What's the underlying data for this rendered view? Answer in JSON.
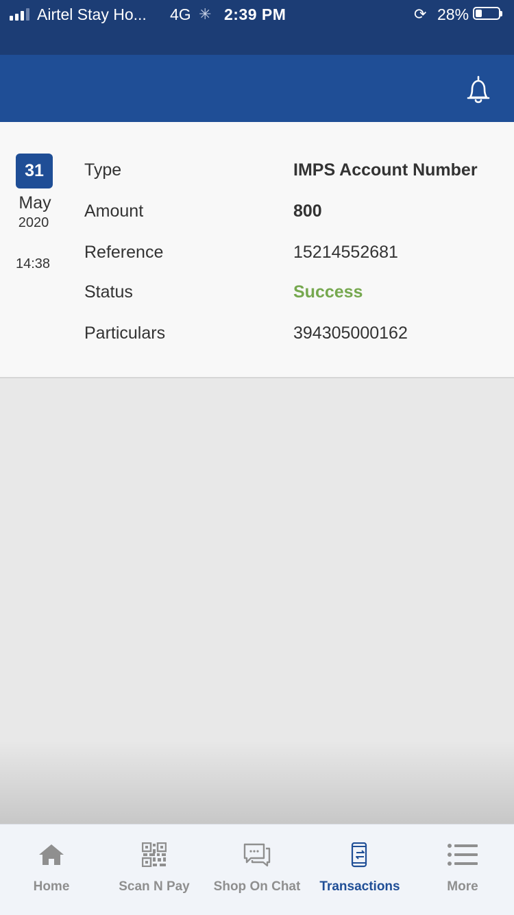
{
  "status_bar": {
    "carrier": "Airtel Stay Ho...",
    "network": "4G",
    "time": "2:39 PM",
    "battery": "28%",
    "battery_level": 0.28
  },
  "header": {
    "icon": "bell-icon"
  },
  "transaction": {
    "date": {
      "day": "31",
      "month": "May",
      "year": "2020",
      "time": "14:38"
    },
    "rows": [
      {
        "label": "Type",
        "value": "IMPS Account Number"
      },
      {
        "label": "Amount",
        "value": "800"
      },
      {
        "label": "Reference",
        "value": "15214552681"
      },
      {
        "label": "Status",
        "value": "Success"
      },
      {
        "label": "Particulars",
        "value": "394305000162"
      }
    ]
  },
  "tabs": [
    {
      "label": "Home",
      "icon": "home-icon",
      "active": false
    },
    {
      "label": "Scan N Pay",
      "icon": "qr-code-icon",
      "active": false
    },
    {
      "label": "Shop On Chat",
      "icon": "chat-icon",
      "active": false
    },
    {
      "label": "Transactions",
      "icon": "transactions-icon",
      "active": true
    },
    {
      "label": "More",
      "icon": "list-icon",
      "active": false
    }
  ],
  "colors": {
    "status_bar": "#1c3d75",
    "header": "#1f4e96",
    "accent": "#1f4e96",
    "success": "#76a84f",
    "inactive_tab": "#8f8f8f"
  }
}
